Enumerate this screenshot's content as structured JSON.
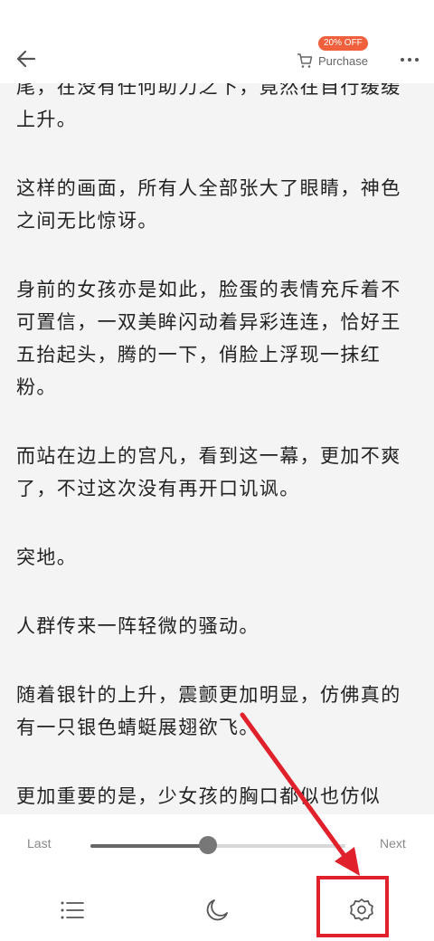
{
  "header": {
    "back_icon": "arrow-left-icon",
    "purchase_label": "Purchase",
    "discount_badge": "20% OFF",
    "cart_icon": "cart-icon",
    "more_icon": "more-horizontal-icon"
  },
  "content": {
    "paragraphs": [
      "尾，在没有任何助力之下，竟然在自行缓缓上升。",
      "这样的画面，所有人全部张大了眼睛，神色之间无比惊讶。",
      "身前的女孩亦是如此，脸蛋的表情充斥着不可置信，一双美眸闪动着异彩连连，恰好王五抬起头，腾的一下，俏脸上浮现一抹红粉。",
      "而站在边上的宫凡，看到这一幕，更加不爽了，不过这次没有再开口讥讽。",
      "突地。",
      "人群传来一阵轻微的骚动。",
      "随着银针的上升，震颤更加明显，仿佛真的有一只银色蜻蜓展翅欲飞。",
      "更加重要的是，少女孩的胸口都似也仿似"
    ]
  },
  "footer": {
    "last_label": "Last",
    "next_label": "Next",
    "progress": 0.46,
    "tools": [
      "list-icon",
      "moon-icon",
      "settings-gear-icon"
    ]
  },
  "annotation": {
    "color": "#e0202a"
  }
}
